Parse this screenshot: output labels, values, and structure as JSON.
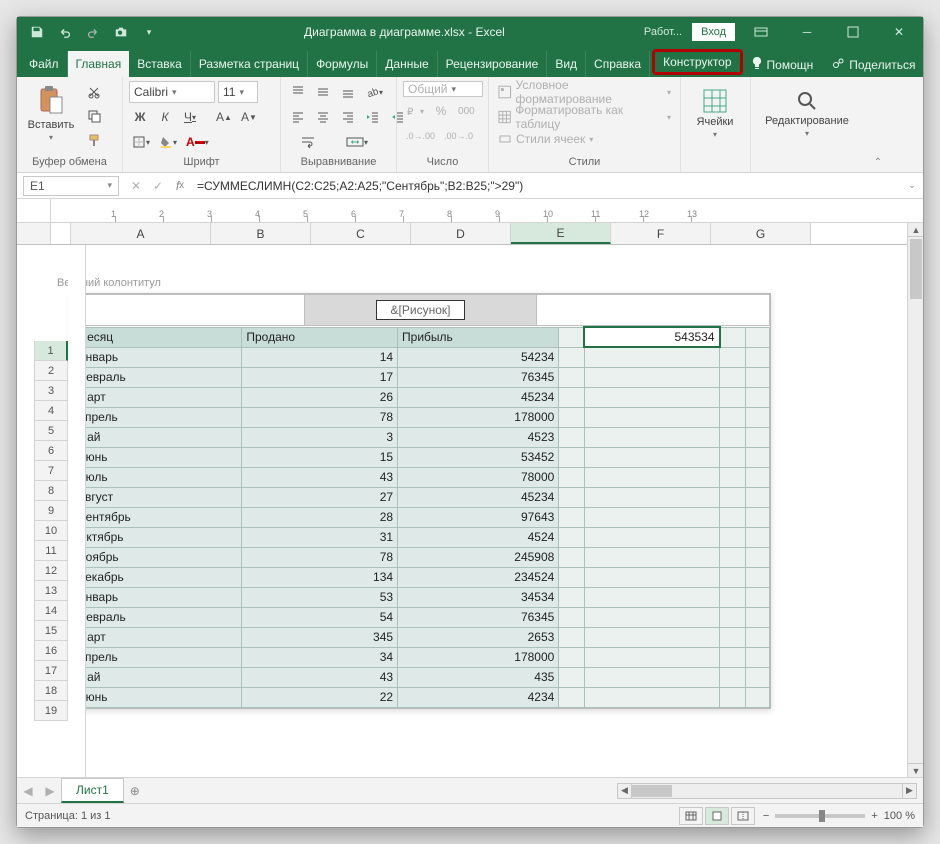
{
  "title": {
    "filename": "Диаграмма в диаграмме.xlsx",
    "app": "Excel",
    "sep": " - "
  },
  "account": {
    "mode": "Работ...",
    "login": "Вход"
  },
  "tabs": [
    "Файл",
    "Главная",
    "Вставка",
    "Разметка страниц",
    "Формулы",
    "Данные",
    "Рецензирование",
    "Вид",
    "Справка",
    "Конструктор"
  ],
  "tabs_active_index": 1,
  "tabs_highlight_index": 9,
  "help_link": "Помощн",
  "share_link": "Поделиться",
  "ribbon": {
    "clipboard": {
      "paste": "Вставить",
      "label": "Буфер обмена"
    },
    "font": {
      "family": "Calibri",
      "size": "11",
      "label": "Шрифт"
    },
    "alignment": {
      "label": "Выравнивание"
    },
    "number": {
      "format": "Общий",
      "label": "Число"
    },
    "styles": {
      "cond": "Условное форматирование",
      "table": "Форматировать как таблицу",
      "cell": "Стили ячеек",
      "label": "Стили"
    },
    "cells": {
      "label": "Ячейки"
    },
    "editing": {
      "label": "Редактирование"
    }
  },
  "namebox": "E1",
  "formula": "=СУММЕСЛИМН(C2:C25;A2:A25;\"Сентябрь\";B2:B25;\">29\")",
  "columns": [
    "A",
    "B",
    "C",
    "D",
    "E",
    "F",
    "G"
  ],
  "selected_col_index": 4,
  "header_footer": {
    "label": "Верхний колонтитул",
    "center": "&[Рисунок]"
  },
  "table": {
    "headers": [
      "Месяц",
      "Продано",
      "Прибыль"
    ],
    "rows": [
      [
        "Январь",
        "14",
        "54234"
      ],
      [
        "Февраль",
        "17",
        "76345"
      ],
      [
        "Март",
        "26",
        "45234"
      ],
      [
        "Апрель",
        "78",
        "178000"
      ],
      [
        "Май",
        "3",
        "4523"
      ],
      [
        "Июнь",
        "15",
        "53452"
      ],
      [
        "Июль",
        "43",
        "78000"
      ],
      [
        "Август",
        "27",
        "45234"
      ],
      [
        "Сентябрь",
        "28",
        "97643"
      ],
      [
        "Октябрь",
        "31",
        "4524"
      ],
      [
        "Ноябрь",
        "78",
        "245908"
      ],
      [
        "Декабрь",
        "134",
        "234524"
      ],
      [
        "Январь",
        "53",
        "34534"
      ],
      [
        "Февраль",
        "54",
        "76345"
      ],
      [
        "Март",
        "345",
        "2653"
      ],
      [
        "Апрель",
        "34",
        "178000"
      ],
      [
        "Май",
        "43",
        "435"
      ],
      [
        "Июнь",
        "22",
        "4234"
      ]
    ],
    "e1_value": "543534"
  },
  "ruler_marks": [
    "1",
    "2",
    "3",
    "4",
    "5",
    "6",
    "7",
    "8",
    "9",
    "10",
    "11",
    "12",
    "13"
  ],
  "sheet_tab": "Лист1",
  "status": "Страница: 1 из 1",
  "zoom": "100 %"
}
